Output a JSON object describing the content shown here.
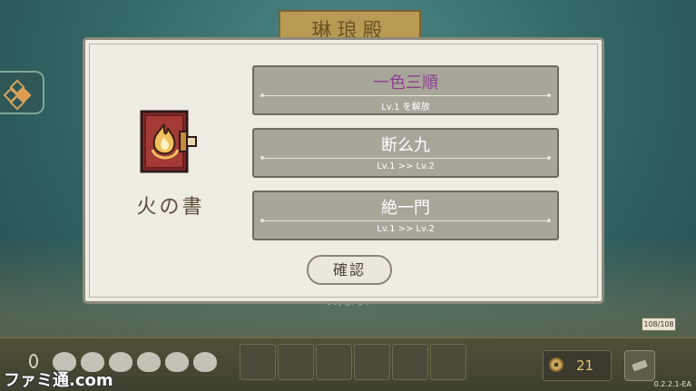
{
  "screen_title": "琳琅殿",
  "background_hint_text": "てみよう!",
  "deck_counter": "108/108",
  "coin_count": "21",
  "version": "0.2.2.1-EA",
  "watermark": "ファミ通.com",
  "dialog": {
    "book": {
      "name": "火の書",
      "icon": "fire-book-icon"
    },
    "options": [
      {
        "title": "一色三順",
        "subtitle": "Lv.1 を解放",
        "highlighted": true
      },
      {
        "title": "断么九",
        "subtitle": "Lv.1 >> Lv.2",
        "highlighted": false
      },
      {
        "title": "絶一門",
        "subtitle": "Lv.1 >> Lv.2",
        "highlighted": false
      }
    ],
    "confirm_label": "確認"
  },
  "colors": {
    "highlight_title": "#8e3f92",
    "option_bg": "#a8a699",
    "dialog_bg": "#efece2"
  }
}
